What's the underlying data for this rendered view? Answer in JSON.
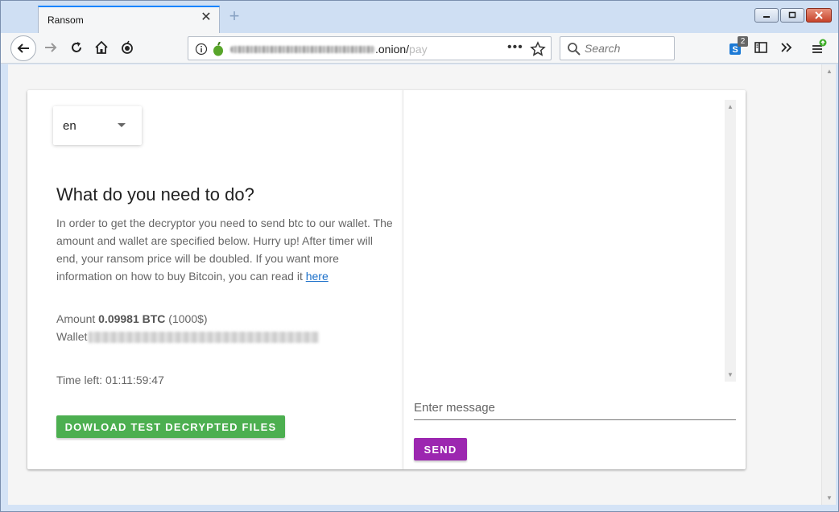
{
  "browser": {
    "tab_title": "Ransom",
    "tab_close_icon": "✕",
    "new_tab_icon": "+",
    "url_visible_tail": ".onion/",
    "url_visible_faded": "pay",
    "search_placeholder": "Search",
    "extension_badge_count": "2",
    "page_actions_label": "•••"
  },
  "page": {
    "language": {
      "selected": "en"
    },
    "heading": "What do you need to do?",
    "description": "In order to get the decryptor you need to send btc to our wallet. The amount and wallet are specified below. Hurry up! After timer will end, your ransom price will be doubled. If you want more information on how to buy Bitcoin, you can read it ",
    "description_link": "here",
    "amount_label": "Amount ",
    "amount_btc": "0.09981 BTC",
    "amount_usd": " (1000$)",
    "wallet_label": "Wallet",
    "time_left_label": "Time left: ",
    "time_left_value": "01:11:59:47",
    "download_button": "DOWLOAD TEST DECRYPTED FILES"
  },
  "chat": {
    "message_placeholder": "Enter message",
    "send_button": "SEND"
  },
  "colors": {
    "accent_tab": "#0a84ff",
    "download_button": "#4caf50",
    "send_button": "#9c27b0",
    "link": "#1a6fc9"
  }
}
